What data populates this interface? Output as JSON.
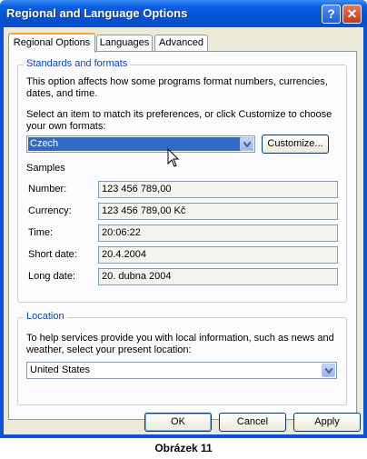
{
  "window": {
    "title": "Regional and Language Options",
    "help_glyph": "?",
    "close_glyph": "✕"
  },
  "tabs": [
    {
      "label": "Regional Options",
      "active": true
    },
    {
      "label": "Languages",
      "active": false
    },
    {
      "label": "Advanced",
      "active": false
    }
  ],
  "standards": {
    "legend": "Standards and formats",
    "description_line1": "This option affects how some programs format numbers, currencies,",
    "description_line2": "dates, and time.",
    "prompt_line1": "Select an item to match its preferences, or click Customize to choose",
    "prompt_line2": "your own formats:",
    "selected_format": "Czech",
    "customize_label": "Customize...",
    "samples_heading": "Samples",
    "samples": [
      {
        "label": "Number:",
        "value": "123 456 789,00"
      },
      {
        "label": "Currency:",
        "value": "123 456 789,00 Kč"
      },
      {
        "label": "Time:",
        "value": "20:06:22"
      },
      {
        "label": "Short date:",
        "value": "20.4.2004"
      },
      {
        "label": "Long date:",
        "value": "20. dubna 2004"
      }
    ]
  },
  "location": {
    "legend": "Location",
    "description_line1": "To help services provide you with local information, such as news and",
    "description_line2": "weather, select your present location:",
    "selected_location": "United States"
  },
  "buttons": {
    "ok": "OK",
    "cancel": "Cancel",
    "apply": "Apply"
  },
  "caption": "Obrázek 11",
  "colors": {
    "titlebar": "#0553d6",
    "dialog_face": "#ece9d8",
    "group_legend": "#0046d5",
    "selection": "#316ac5",
    "active_tab_accent": "#f5a443"
  }
}
